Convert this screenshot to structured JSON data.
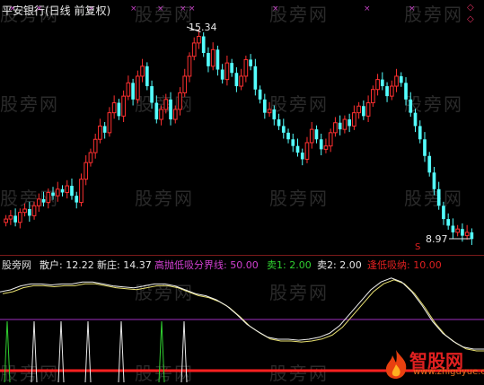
{
  "watermark": "股旁网",
  "header": {
    "title": "平安银行(日线 前复权)"
  },
  "chart": {
    "high_label": "15.34",
    "low_label": "8.97",
    "period_marker": "S",
    "corner_icon": "◇",
    "colors": {
      "up": "#ff3030",
      "down": "#54ffff",
      "marker": "#c040c0",
      "white": "#e8e8e8"
    }
  },
  "indicator": {
    "name": "股旁网",
    "retail": "散户: 12.22",
    "dealer": "新庄: 14.37",
    "threshold": "高抛低吸分界线: 50.00",
    "sell1": "卖1: 2.00",
    "sell2": "卖2: 2.00",
    "buy_low": "逢低吸纳: 10.00"
  },
  "logo": {
    "name": "智股网",
    "url": "www.zhiguyue.com"
  },
  "chart_data": {
    "type": "candlestick",
    "price_range": [
      8.9,
      15.6
    ],
    "high": 15.34,
    "low": 8.97,
    "closes": [
      9.6,
      9.7,
      9.5,
      9.8,
      9.9,
      9.7,
      10.0,
      10.2,
      10.1,
      10.4,
      10.3,
      10.5,
      10.4,
      10.6,
      10.3,
      10.1,
      10.8,
      11.3,
      11.6,
      12.0,
      12.4,
      12.2,
      12.8,
      13.1,
      12.7,
      13.3,
      13.7,
      13.2,
      13.9,
      14.2,
      13.6,
      13.1,
      12.6,
      12.9,
      13.2,
      12.6,
      12.9,
      13.4,
      13.9,
      14.5,
      14.9,
      15.1,
      14.6,
      14.2,
      14.7,
      14.1,
      13.8,
      14.3,
      14.0,
      13.6,
      13.9,
      14.4,
      14.2,
      13.5,
      13.2,
      12.8,
      12.9,
      12.6,
      12.4,
      12.2,
      12.0,
      11.8,
      11.6,
      11.4,
      11.9,
      12.3,
      12.0,
      11.7,
      11.8,
      12.2,
      12.5,
      12.3,
      12.6,
      12.4,
      12.8,
      13.0,
      12.7,
      13.1,
      13.5,
      13.8,
      13.6,
      13.3,
      13.6,
      13.9,
      13.7,
      13.2,
      12.8,
      12.4,
      12.0,
      11.5,
      11.0,
      10.5,
      10.0,
      9.6,
      9.4,
      9.2,
      9.3,
      9.1,
      9.2,
      9.0
    ],
    "indicator_levels": {
      "threshold": 50.0,
      "sell1": 2.0,
      "buy_low": 10.0
    },
    "indicator_line": [
      78,
      80,
      84,
      86,
      86,
      85,
      86,
      86,
      88,
      88,
      86,
      84,
      83,
      82,
      84,
      86,
      86,
      84,
      80,
      76,
      74,
      70,
      64,
      55,
      45,
      38,
      32,
      30,
      30,
      29,
      30,
      32,
      36,
      44,
      56,
      68,
      80,
      88,
      92,
      88,
      78,
      64,
      48,
      36,
      28,
      22,
      20,
      20
    ]
  }
}
